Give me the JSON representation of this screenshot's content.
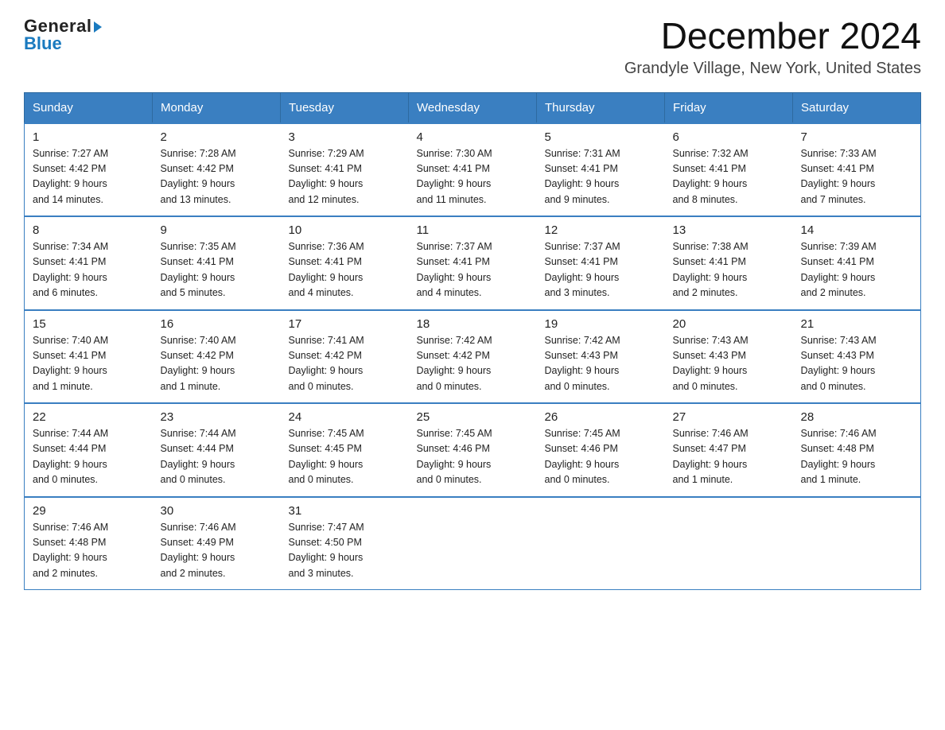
{
  "header": {
    "logo_general": "General",
    "logo_blue": "Blue",
    "month_title": "December 2024",
    "location": "Grandyle Village, New York, United States"
  },
  "days_of_week": [
    "Sunday",
    "Monday",
    "Tuesday",
    "Wednesday",
    "Thursday",
    "Friday",
    "Saturday"
  ],
  "weeks": [
    [
      {
        "day": "1",
        "sunrise": "7:27 AM",
        "sunset": "4:42 PM",
        "daylight": "9 hours and 14 minutes."
      },
      {
        "day": "2",
        "sunrise": "7:28 AM",
        "sunset": "4:42 PM",
        "daylight": "9 hours and 13 minutes."
      },
      {
        "day": "3",
        "sunrise": "7:29 AM",
        "sunset": "4:41 PM",
        "daylight": "9 hours and 12 minutes."
      },
      {
        "day": "4",
        "sunrise": "7:30 AM",
        "sunset": "4:41 PM",
        "daylight": "9 hours and 11 minutes."
      },
      {
        "day": "5",
        "sunrise": "7:31 AM",
        "sunset": "4:41 PM",
        "daylight": "9 hours and 9 minutes."
      },
      {
        "day": "6",
        "sunrise": "7:32 AM",
        "sunset": "4:41 PM",
        "daylight": "9 hours and 8 minutes."
      },
      {
        "day": "7",
        "sunrise": "7:33 AM",
        "sunset": "4:41 PM",
        "daylight": "9 hours and 7 minutes."
      }
    ],
    [
      {
        "day": "8",
        "sunrise": "7:34 AM",
        "sunset": "4:41 PM",
        "daylight": "9 hours and 6 minutes."
      },
      {
        "day": "9",
        "sunrise": "7:35 AM",
        "sunset": "4:41 PM",
        "daylight": "9 hours and 5 minutes."
      },
      {
        "day": "10",
        "sunrise": "7:36 AM",
        "sunset": "4:41 PM",
        "daylight": "9 hours and 4 minutes."
      },
      {
        "day": "11",
        "sunrise": "7:37 AM",
        "sunset": "4:41 PM",
        "daylight": "9 hours and 4 minutes."
      },
      {
        "day": "12",
        "sunrise": "7:37 AM",
        "sunset": "4:41 PM",
        "daylight": "9 hours and 3 minutes."
      },
      {
        "day": "13",
        "sunrise": "7:38 AM",
        "sunset": "4:41 PM",
        "daylight": "9 hours and 2 minutes."
      },
      {
        "day": "14",
        "sunrise": "7:39 AM",
        "sunset": "4:41 PM",
        "daylight": "9 hours and 2 minutes."
      }
    ],
    [
      {
        "day": "15",
        "sunrise": "7:40 AM",
        "sunset": "4:41 PM",
        "daylight": "9 hours and 1 minute."
      },
      {
        "day": "16",
        "sunrise": "7:40 AM",
        "sunset": "4:42 PM",
        "daylight": "9 hours and 1 minute."
      },
      {
        "day": "17",
        "sunrise": "7:41 AM",
        "sunset": "4:42 PM",
        "daylight": "9 hours and 0 minutes."
      },
      {
        "day": "18",
        "sunrise": "7:42 AM",
        "sunset": "4:42 PM",
        "daylight": "9 hours and 0 minutes."
      },
      {
        "day": "19",
        "sunrise": "7:42 AM",
        "sunset": "4:43 PM",
        "daylight": "9 hours and 0 minutes."
      },
      {
        "day": "20",
        "sunrise": "7:43 AM",
        "sunset": "4:43 PM",
        "daylight": "9 hours and 0 minutes."
      },
      {
        "day": "21",
        "sunrise": "7:43 AM",
        "sunset": "4:43 PM",
        "daylight": "9 hours and 0 minutes."
      }
    ],
    [
      {
        "day": "22",
        "sunrise": "7:44 AM",
        "sunset": "4:44 PM",
        "daylight": "9 hours and 0 minutes."
      },
      {
        "day": "23",
        "sunrise": "7:44 AM",
        "sunset": "4:44 PM",
        "daylight": "9 hours and 0 minutes."
      },
      {
        "day": "24",
        "sunrise": "7:45 AM",
        "sunset": "4:45 PM",
        "daylight": "9 hours and 0 minutes."
      },
      {
        "day": "25",
        "sunrise": "7:45 AM",
        "sunset": "4:46 PM",
        "daylight": "9 hours and 0 minutes."
      },
      {
        "day": "26",
        "sunrise": "7:45 AM",
        "sunset": "4:46 PM",
        "daylight": "9 hours and 0 minutes."
      },
      {
        "day": "27",
        "sunrise": "7:46 AM",
        "sunset": "4:47 PM",
        "daylight": "9 hours and 1 minute."
      },
      {
        "day": "28",
        "sunrise": "7:46 AM",
        "sunset": "4:48 PM",
        "daylight": "9 hours and 1 minute."
      }
    ],
    [
      {
        "day": "29",
        "sunrise": "7:46 AM",
        "sunset": "4:48 PM",
        "daylight": "9 hours and 2 minutes."
      },
      {
        "day": "30",
        "sunrise": "7:46 AM",
        "sunset": "4:49 PM",
        "daylight": "9 hours and 2 minutes."
      },
      {
        "day": "31",
        "sunrise": "7:47 AM",
        "sunset": "4:50 PM",
        "daylight": "9 hours and 3 minutes."
      },
      null,
      null,
      null,
      null
    ]
  ],
  "labels": {
    "sunrise": "Sunrise:",
    "sunset": "Sunset:",
    "daylight": "Daylight:"
  }
}
